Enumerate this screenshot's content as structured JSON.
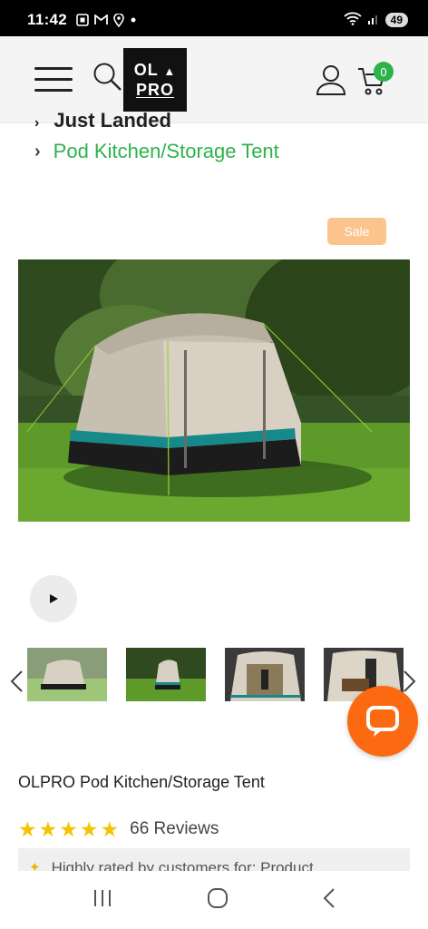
{
  "status_bar": {
    "time": "11:42",
    "battery": "49"
  },
  "header": {
    "logo_line1": "OL",
    "logo_line2": "PRO",
    "cart_count": "0"
  },
  "breadcrumb": {
    "previous": "Just Landed",
    "current": "Pod Kitchen/Storage Tent"
  },
  "badges": {
    "sale": "Sale"
  },
  "product": {
    "title": "OLPRO Pod Kitchen/Storage Tent",
    "rating": 5,
    "reviews_label": "66 Reviews",
    "highlight": "Highly rated by customers for: Product"
  },
  "icons": {
    "menu": "hamburger-icon",
    "search": "search-icon",
    "account": "user-icon",
    "cart": "cart-icon",
    "play": "play-icon",
    "prev": "chevron-left-icon",
    "next": "chevron-right-icon",
    "chat": "chat-icon"
  },
  "colors": {
    "brand_green": "#2db34a",
    "sale": "#fcc48d",
    "chat": "#fb6a10",
    "star": "#f5c300"
  }
}
